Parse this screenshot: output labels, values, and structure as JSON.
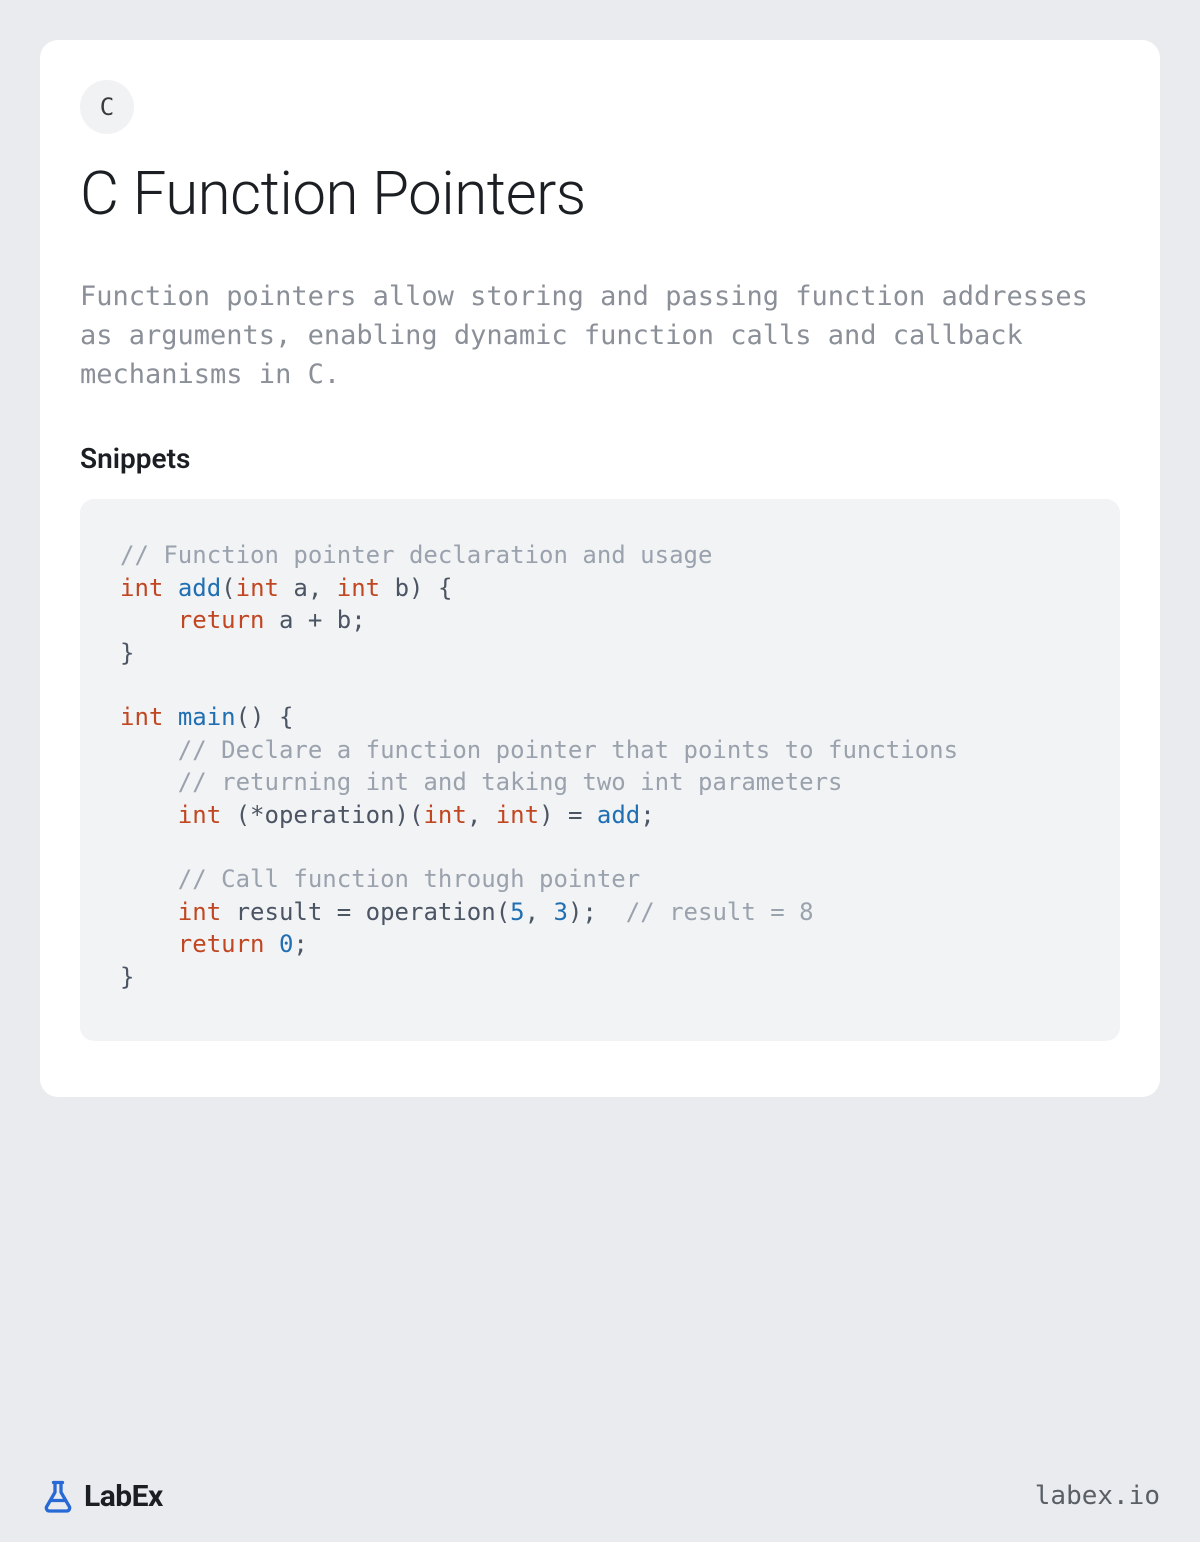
{
  "badge_letter": "C",
  "title": "C Function Pointers",
  "description": "Function pointers allow storing and passing function addresses as arguments, enabling dynamic function calls and callback mechanisms in C.",
  "section_heading": "Snippets",
  "code": {
    "l01": "// Function pointer declaration and usage",
    "l02a": "int",
    "l02b": " ",
    "l02c": "add",
    "l02d": "(",
    "l02e": "int",
    "l02f": " a, ",
    "l02g": "int",
    "l02h": " b) {",
    "l03a": "    ",
    "l03b": "return",
    "l03c": " a + b;",
    "l04": "}",
    "l06a": "int",
    "l06b": " ",
    "l06c": "main",
    "l06d": "() {",
    "l07": "    // Declare a function pointer that points to functions",
    "l08": "    // returning int and taking two int parameters",
    "l09a": "    ",
    "l09b": "int",
    "l09c": " (*operation)(",
    "l09d": "int",
    "l09e": ", ",
    "l09f": "int",
    "l09g": ") = ",
    "l09h": "add",
    "l09i": ";",
    "l11": "    // Call function through pointer",
    "l12a": "    ",
    "l12b": "int",
    "l12c": " result = operation(",
    "l12d": "5",
    "l12e": ", ",
    "l12f": "3",
    "l12g": ");  ",
    "l12h": "// result = 8",
    "l13a": "    ",
    "l13b": "return",
    "l13c": " ",
    "l13d": "0",
    "l13e": ";",
    "l14": "}"
  },
  "brand": {
    "name": "LabEx"
  },
  "site": "labex.io"
}
